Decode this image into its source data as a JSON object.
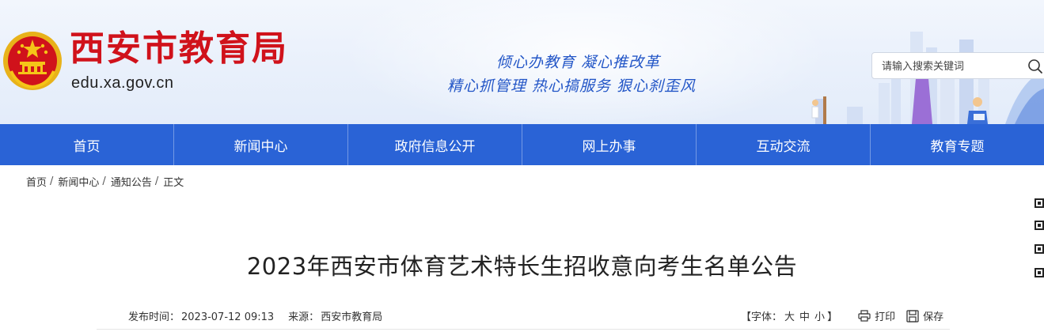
{
  "header": {
    "site_name": "西安市教育局",
    "site_domain": "edu.xa.gov.cn",
    "slogan_line1": "倾心办教育  凝心推改革",
    "slogan_line2": "精心抓管理  热心搞服务  狠心刹歪风",
    "emblem_icon": "national-emblem-icon"
  },
  "search": {
    "placeholder": "请输入搜索关键词",
    "icon": "search-icon"
  },
  "nav": {
    "items": [
      {
        "label": "首页"
      },
      {
        "label": "新闻中心"
      },
      {
        "label": "政府信息公开"
      },
      {
        "label": "网上办事"
      },
      {
        "label": "互动交流"
      },
      {
        "label": "教育专题"
      }
    ]
  },
  "breadcrumb": {
    "items": [
      "首页",
      "新闻中心",
      "通知公告",
      "正文"
    ],
    "separator": "/"
  },
  "article": {
    "title": "2023年西安市体育艺术特长生招收意向考生名单公告",
    "publish_label": "发布时间：",
    "publish_time": "2023-07-12 09:13",
    "source_label": "来源：",
    "source": "西安市教育局"
  },
  "tools": {
    "font_open": "【字体：",
    "font_large": "大",
    "font_medium": "中",
    "font_small": "小",
    "font_close": "】",
    "print_label": "打印",
    "save_label": "保存"
  },
  "colors": {
    "brand_red": "#d0121b",
    "nav_blue": "#2a63d6",
    "slogan_blue": "#2356c7"
  }
}
